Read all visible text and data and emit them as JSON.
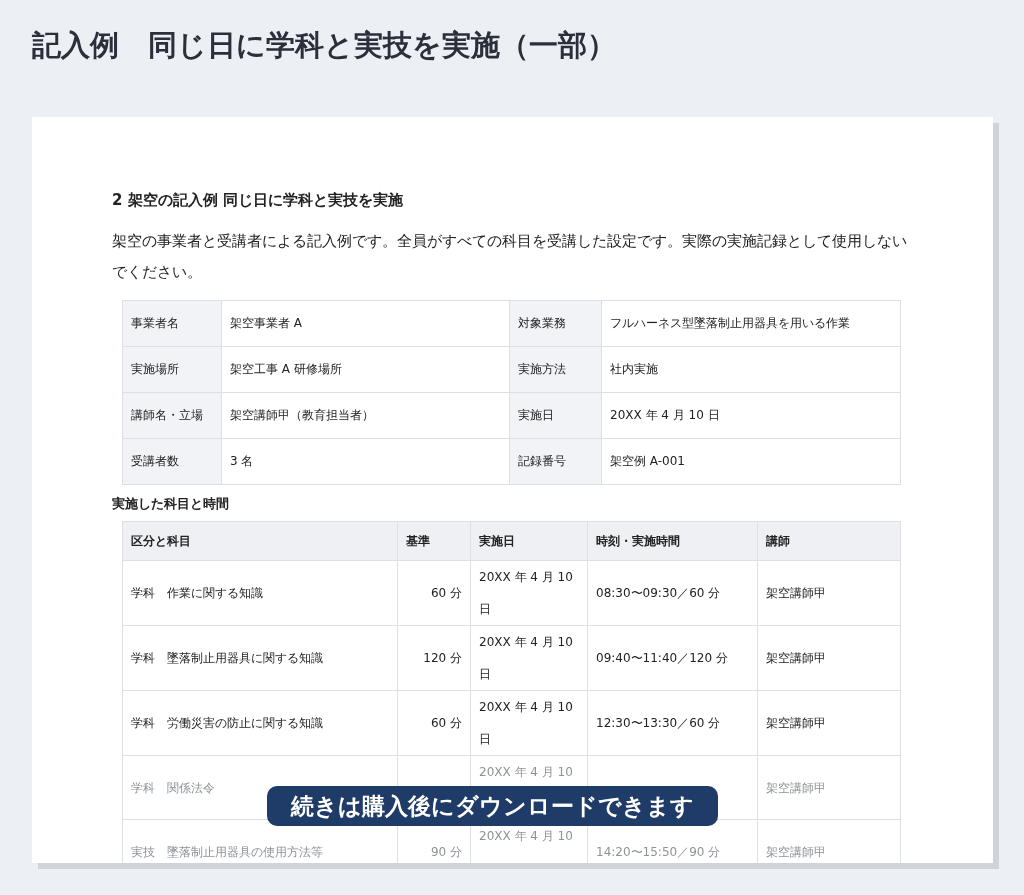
{
  "page_title": "記入例　同じ日に学科と実技を実施（一部）",
  "document": {
    "heading": "2 架空の記入例 同じ日に学科と実技を実施",
    "description": "架空の事業者と受講者による記入例です。全員がすべての科目を受講した設定です。実際の実施記録として使用しないでください。",
    "info_rows": [
      {
        "label_1": "事業者名",
        "value_1": "架空事業者 A",
        "label_2": "対象業務",
        "value_2": "フルハーネス型墜落制止用器具を用いる作業"
      },
      {
        "label_1": "実施場所",
        "value_1": "架空工事 A 研修場所",
        "label_2": "実施方法",
        "value_2": "社内実施"
      },
      {
        "label_1": "講師名・立場",
        "value_1": "架空講師甲（教育担当者）",
        "label_2": "実施日",
        "value_2": "20XX 年 4 月 10 日"
      },
      {
        "label_1": "受講者数",
        "value_1": "3 名",
        "label_2": "記録番号",
        "value_2": "架空例 A-001"
      }
    ],
    "schedule_title": "実施した科目と時間",
    "columns": [
      "区分と科目",
      "基準",
      "実施日",
      "時刻・実施時間",
      "講師"
    ],
    "rows": [
      {
        "subject": "学科　作業に関する知識",
        "standard": "60 分",
        "date": "20XX 年 4 月 10 日",
        "time": "08:30〜09:30／60 分",
        "teacher": "架空講師甲",
        "faded": false
      },
      {
        "subject": "学科　墜落制止用器具に関する知識",
        "standard": "120 分",
        "date": "20XX 年 4 月 10 日",
        "time": "09:40〜11:40／120 分",
        "teacher": "架空講師甲",
        "faded": false
      },
      {
        "subject": "学科　労働災害の防止に関する知識",
        "standard": "60 分",
        "date": "20XX 年 4 月 10 日",
        "time": "12:30〜13:30／60 分",
        "teacher": "架空講師甲",
        "faded": false
      },
      {
        "subject": "学科　関係法令",
        "date": "20XX 年 4 月 10",
        "teacher": "架空講師甲",
        "faded": true
      },
      {
        "subject": "実技　墜落制止用器具の使用方法等",
        "standard": "90 分",
        "date": "20XX 年 4 月 10",
        "time": "14:20〜15:50／90 分",
        "teacher": "架空講師甲",
        "faded": true
      }
    ]
  },
  "banner": "続きは購入後にダウンロードできます"
}
